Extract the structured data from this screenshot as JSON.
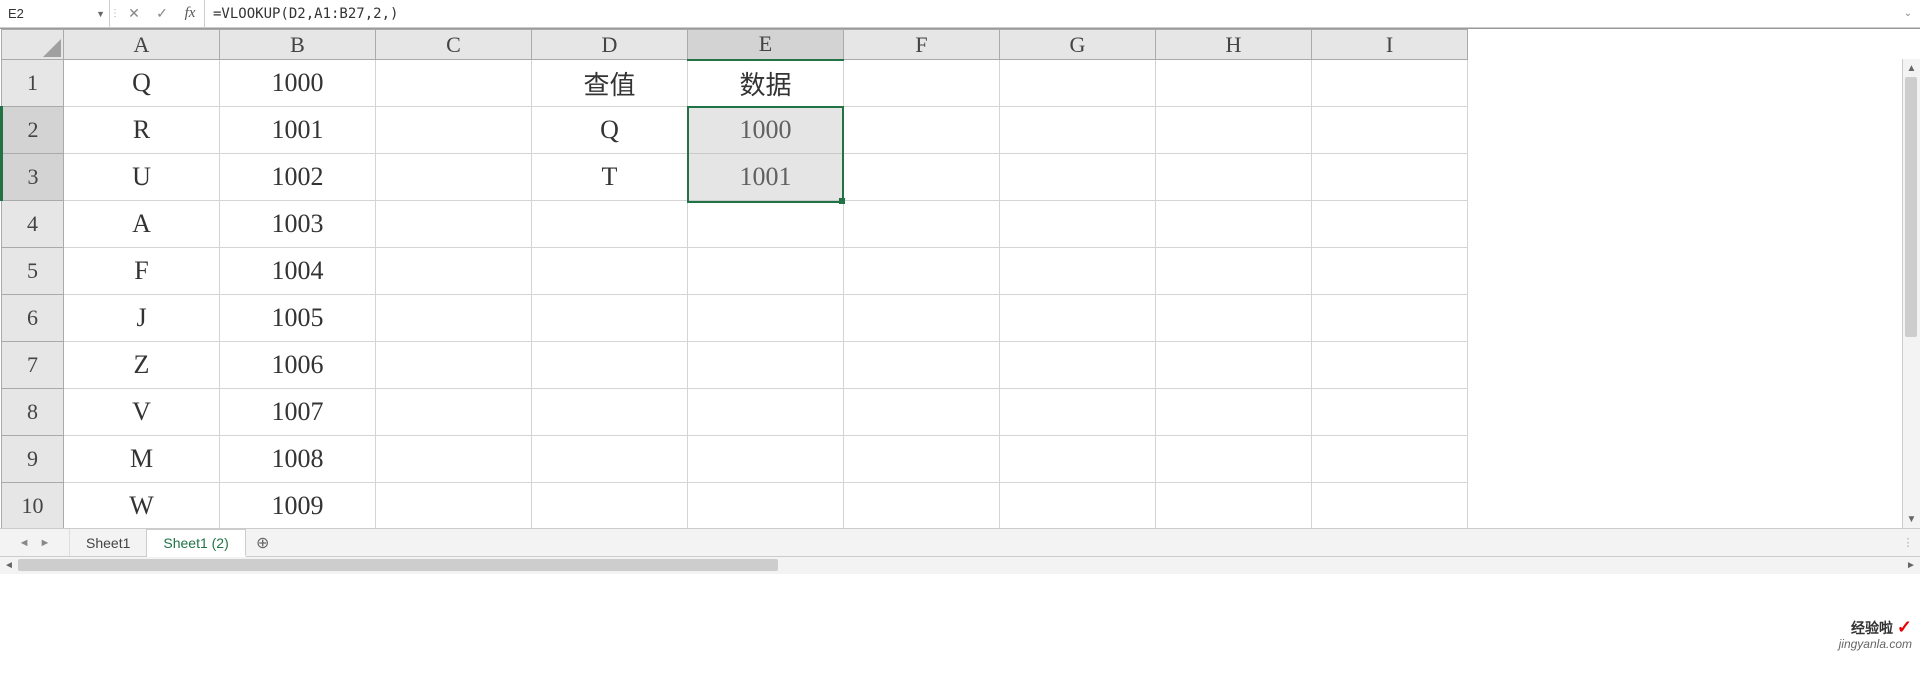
{
  "formula_bar": {
    "cell_ref": "E2",
    "formula": "=VLOOKUP(D2,A1:B27,2,)",
    "cancel": "✕",
    "confirm": "✓",
    "fx": "fx"
  },
  "columns": [
    "A",
    "B",
    "C",
    "D",
    "E",
    "F",
    "G",
    "H",
    "I"
  ],
  "rows": [
    "1",
    "2",
    "3",
    "4",
    "5",
    "6",
    "7",
    "8",
    "9",
    "10"
  ],
  "cells": {
    "A1": "Q",
    "B1": "1000",
    "D1": "查值",
    "E1": "数据",
    "A2": "R",
    "B2": "1001",
    "D2": "Q",
    "E2": "1000",
    "A3": "U",
    "B3": "1002",
    "D3": "T",
    "E3": "1001",
    "A4": "A",
    "B4": "1003",
    "A5": "F",
    "B5": "1004",
    "A6": "J",
    "B6": "1005",
    "A7": "Z",
    "B7": "1006",
    "A8": "V",
    "B8": "1007",
    "A9": "M",
    "B9": "1008",
    "A10": "W",
    "B10": "1009"
  },
  "selected_col": "E",
  "selected_rows": [
    "2",
    "3"
  ],
  "tabs": {
    "sheets": [
      "Sheet1",
      "Sheet1 (2)"
    ],
    "active": "Sheet1 (2)",
    "add": "⊕"
  },
  "watermark": {
    "line1": "经验啦",
    "check": "✓",
    "line2": "jingyanla.com"
  }
}
